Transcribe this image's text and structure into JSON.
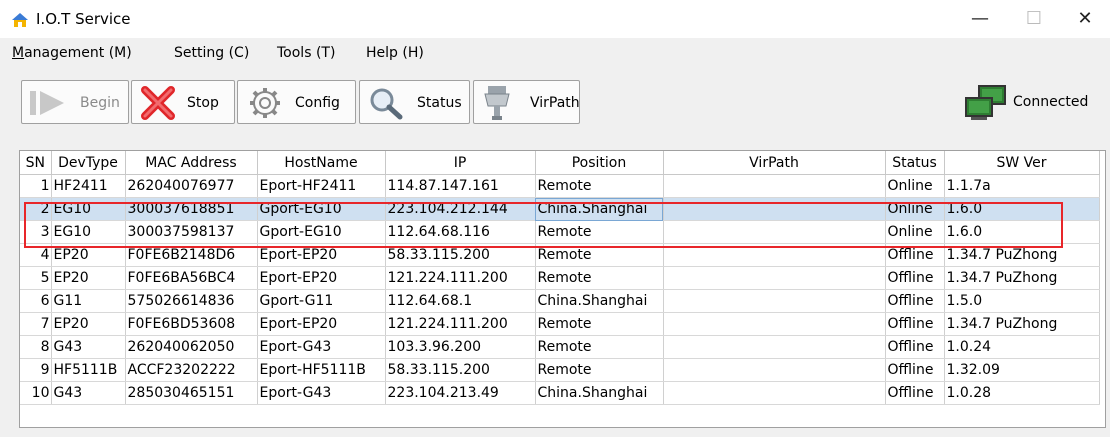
{
  "window": {
    "title": "I.O.T Service",
    "minimize": "—",
    "maximize": "☐",
    "close": "✕"
  },
  "menu": [
    {
      "label": "Management (M)",
      "underline": "M",
      "rest": "anagement (M)"
    },
    {
      "label": "Setting (C)"
    },
    {
      "label": "Tools (T)"
    },
    {
      "label": "Help (H)"
    }
  ],
  "toolbar": {
    "begin": "Begin",
    "stop": "Stop",
    "config": "Config",
    "status": "Status",
    "virpath": "VirPath",
    "connected": "Connected"
  },
  "colors": {
    "selection": "#cfe0f1",
    "highlight_box": "#e8262a",
    "stop_icon": "#e0262a"
  },
  "table": {
    "columns": [
      "SN",
      "DevType",
      "MAC Address",
      "HostName",
      "IP",
      "Position",
      "VirPath",
      "Status",
      "SW Ver"
    ],
    "rows": [
      {
        "sn": "1",
        "devtype": "HF2411",
        "mac": "262040076977",
        "host": "Eport-HF2411",
        "ip": "114.87.147.161",
        "position": "Remote",
        "virpath": "",
        "status": "Online",
        "swver": "1.1.7a"
      },
      {
        "sn": "2",
        "devtype": "EG10",
        "mac": "300037618851",
        "host": "Gport-EG10",
        "ip": "223.104.212.144",
        "position": "China.Shanghai",
        "virpath": "",
        "status": "Online",
        "swver": "1.6.0"
      },
      {
        "sn": "3",
        "devtype": "EG10",
        "mac": "300037598137",
        "host": "Gport-EG10",
        "ip": "112.64.68.116",
        "position": "Remote",
        "virpath": "",
        "status": "Online",
        "swver": "1.6.0"
      },
      {
        "sn": "4",
        "devtype": "EP20",
        "mac": "F0FE6B2148D6",
        "host": "Eport-EP20",
        "ip": "58.33.115.200",
        "position": "Remote",
        "virpath": "",
        "status": "Offline",
        "swver": "1.34.7 PuZhong"
      },
      {
        "sn": "5",
        "devtype": "EP20",
        "mac": "F0FE6BA56BC4",
        "host": "Eport-EP20",
        "ip": "121.224.111.200",
        "position": "Remote",
        "virpath": "",
        "status": "Offline",
        "swver": "1.34.7 PuZhong"
      },
      {
        "sn": "6",
        "devtype": "G11",
        "mac": "575026614836",
        "host": "Gport-G11",
        "ip": "112.64.68.1",
        "position": "China.Shanghai",
        "virpath": "",
        "status": "Offline",
        "swver": "1.5.0"
      },
      {
        "sn": "7",
        "devtype": "EP20",
        "mac": "F0FE6BD53608",
        "host": "Eport-EP20",
        "ip": "121.224.111.200",
        "position": "Remote",
        "virpath": "",
        "status": "Offline",
        "swver": "1.34.7 PuZhong"
      },
      {
        "sn": "8",
        "devtype": "G43",
        "mac": "262040062050",
        "host": "Eport-G43",
        "ip": "103.3.96.200",
        "position": "Remote",
        "virpath": "",
        "status": "Offline",
        "swver": "1.0.24"
      },
      {
        "sn": "9",
        "devtype": "HF5111B",
        "mac": "ACCF23202222",
        "host": "Eport-HF5111B",
        "ip": "58.33.115.200",
        "position": "Remote",
        "virpath": "",
        "status": "Offline",
        "swver": "1.32.09"
      },
      {
        "sn": "10",
        "devtype": "G43",
        "mac": "285030465151",
        "host": "Eport-G43",
        "ip": "223.104.213.49",
        "position": "China.Shanghai",
        "virpath": "",
        "status": "Offline",
        "swver": "1.0.28"
      }
    ]
  }
}
